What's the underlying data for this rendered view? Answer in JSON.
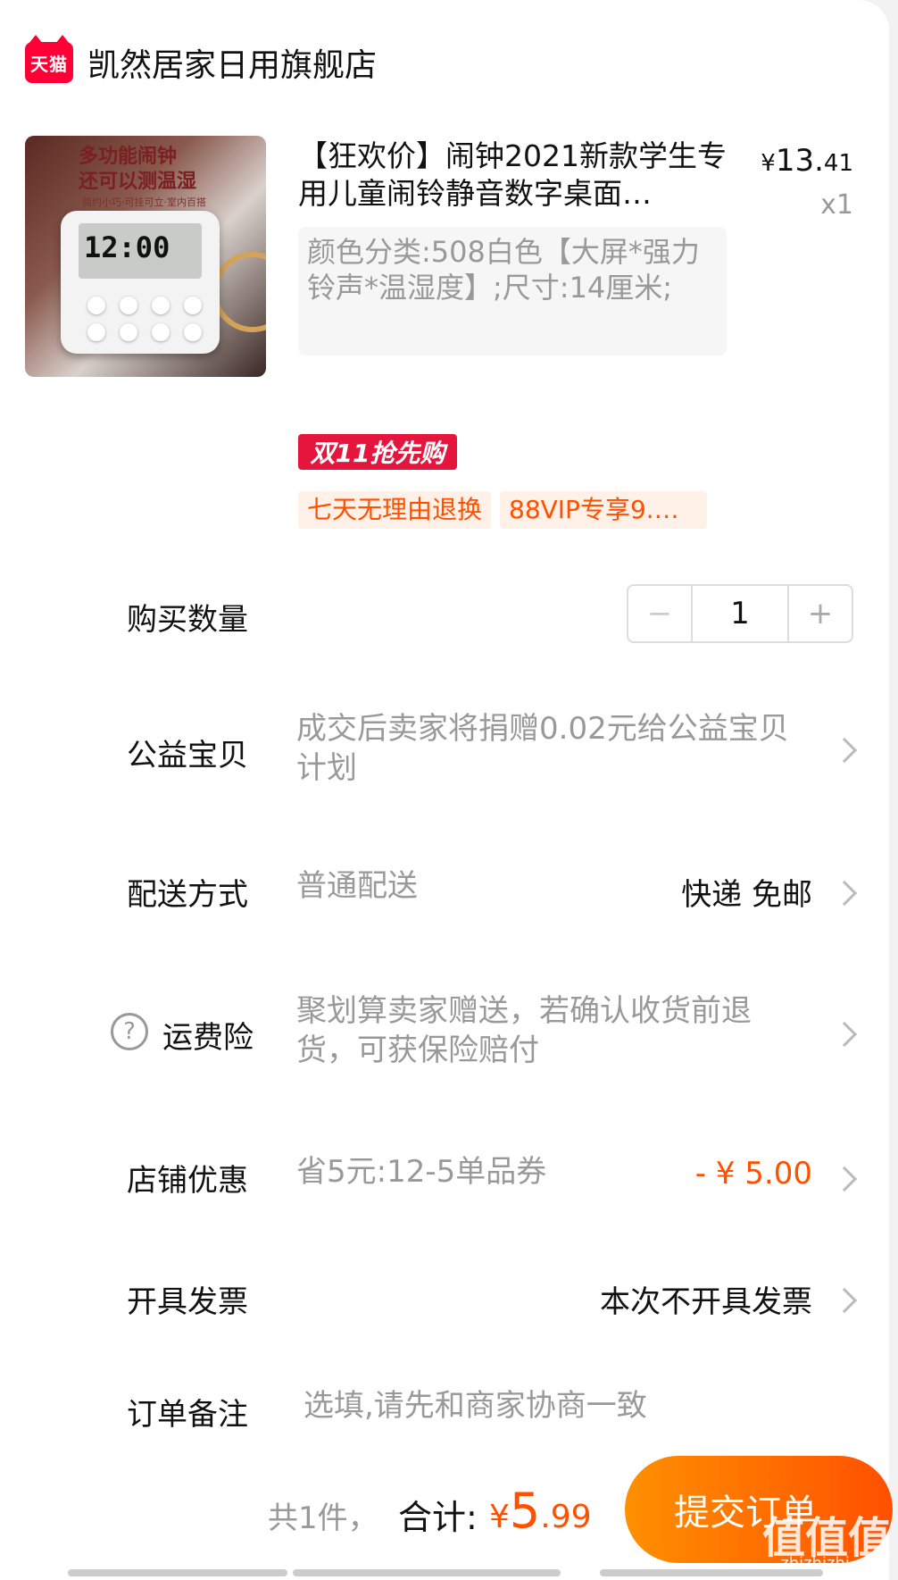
{
  "shop": {
    "logo_text": "天猫",
    "name": "凯然居家日用旗舰店"
  },
  "product": {
    "image_caption_1": "多功能闹钟",
    "image_caption_2": "还可以测温湿",
    "image_sub": "简约小巧·可挂可立·室内百搭",
    "clock_display": "12:00",
    "title": "【狂欢价】闹钟2021新款学生专用儿童闹铃静音数字桌面…",
    "price_currency": "¥",
    "price_int": "13.",
    "price_dec": "41",
    "quantity_label": "x1",
    "sku": "颜色分类:508白色【大屏*强力铃声*温湿度】;尺寸:14厘米;",
    "promo_tag": "双11抢先购",
    "service_tags": [
      "七天无理由退换",
      "88VIP专享9.…"
    ]
  },
  "rows": {
    "quantity": {
      "label": "购买数量",
      "value": "1",
      "minus": "−",
      "plus": "+"
    },
    "charity": {
      "label": "公益宝贝",
      "value": "成交后卖家将捐赠0.02元给公益宝贝计划"
    },
    "delivery": {
      "label": "配送方式",
      "value": "普通配送",
      "right": "快递 免邮"
    },
    "insurance": {
      "label": "运费险",
      "help": "?",
      "value": "聚划算卖家赠送，若确认收货前退货，可获保险赔付"
    },
    "coupon": {
      "label": "店铺优惠",
      "value": "省5元:12-5单品券",
      "right": "- ¥ 5.00"
    },
    "invoice": {
      "label": "开具发票",
      "right": "本次不开具发票"
    },
    "note": {
      "label": "订单备注",
      "placeholder": "选填,请先和商家协商一致"
    }
  },
  "summary": {
    "count": "共1件，",
    "total_label": "合计:",
    "currency": "¥",
    "total_int": "5",
    "total_dec": ".99",
    "submit": "提交订单"
  },
  "watermark": {
    "text": "值值值",
    "sub": "zhizhizhi.com"
  },
  "colors": {
    "accent": "#ff5000",
    "tmall_red": "#ff0036",
    "promo_red": "#e5163e"
  }
}
